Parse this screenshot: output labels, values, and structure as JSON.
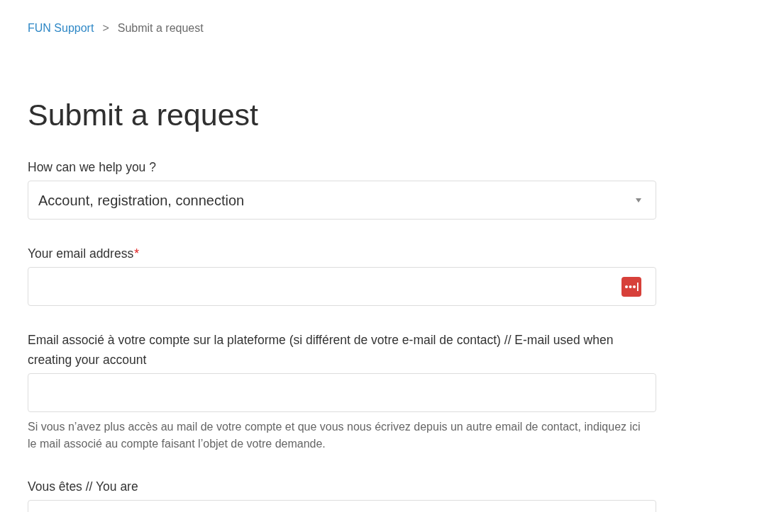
{
  "breadcrumb": {
    "separator": ">",
    "items": [
      {
        "kind": "link",
        "label": "FUN Support"
      },
      {
        "kind": "current",
        "label": "Submit a request"
      }
    ]
  },
  "title": "Submit a request",
  "fields": [
    {
      "kind": "select",
      "label": "How can we help you ?",
      "value": "Account, registration, connection"
    },
    {
      "kind": "email",
      "label": "Your email address",
      "required_mark": "*"
    },
    {
      "kind": "text",
      "label": "Email associé à votre compte sur la plateforme (si différent de votre e-mail de contact) // E-mail used when creating your account",
      "hint": "Si vous n’avez plus accès au mail de votre compte et que vous nous écrivez depuis un autre email de contact, indiquez ici le mail associé au compte faisant l’objet de votre demande."
    },
    {
      "kind": "text",
      "label": "Vous êtes // You are"
    }
  ]
}
